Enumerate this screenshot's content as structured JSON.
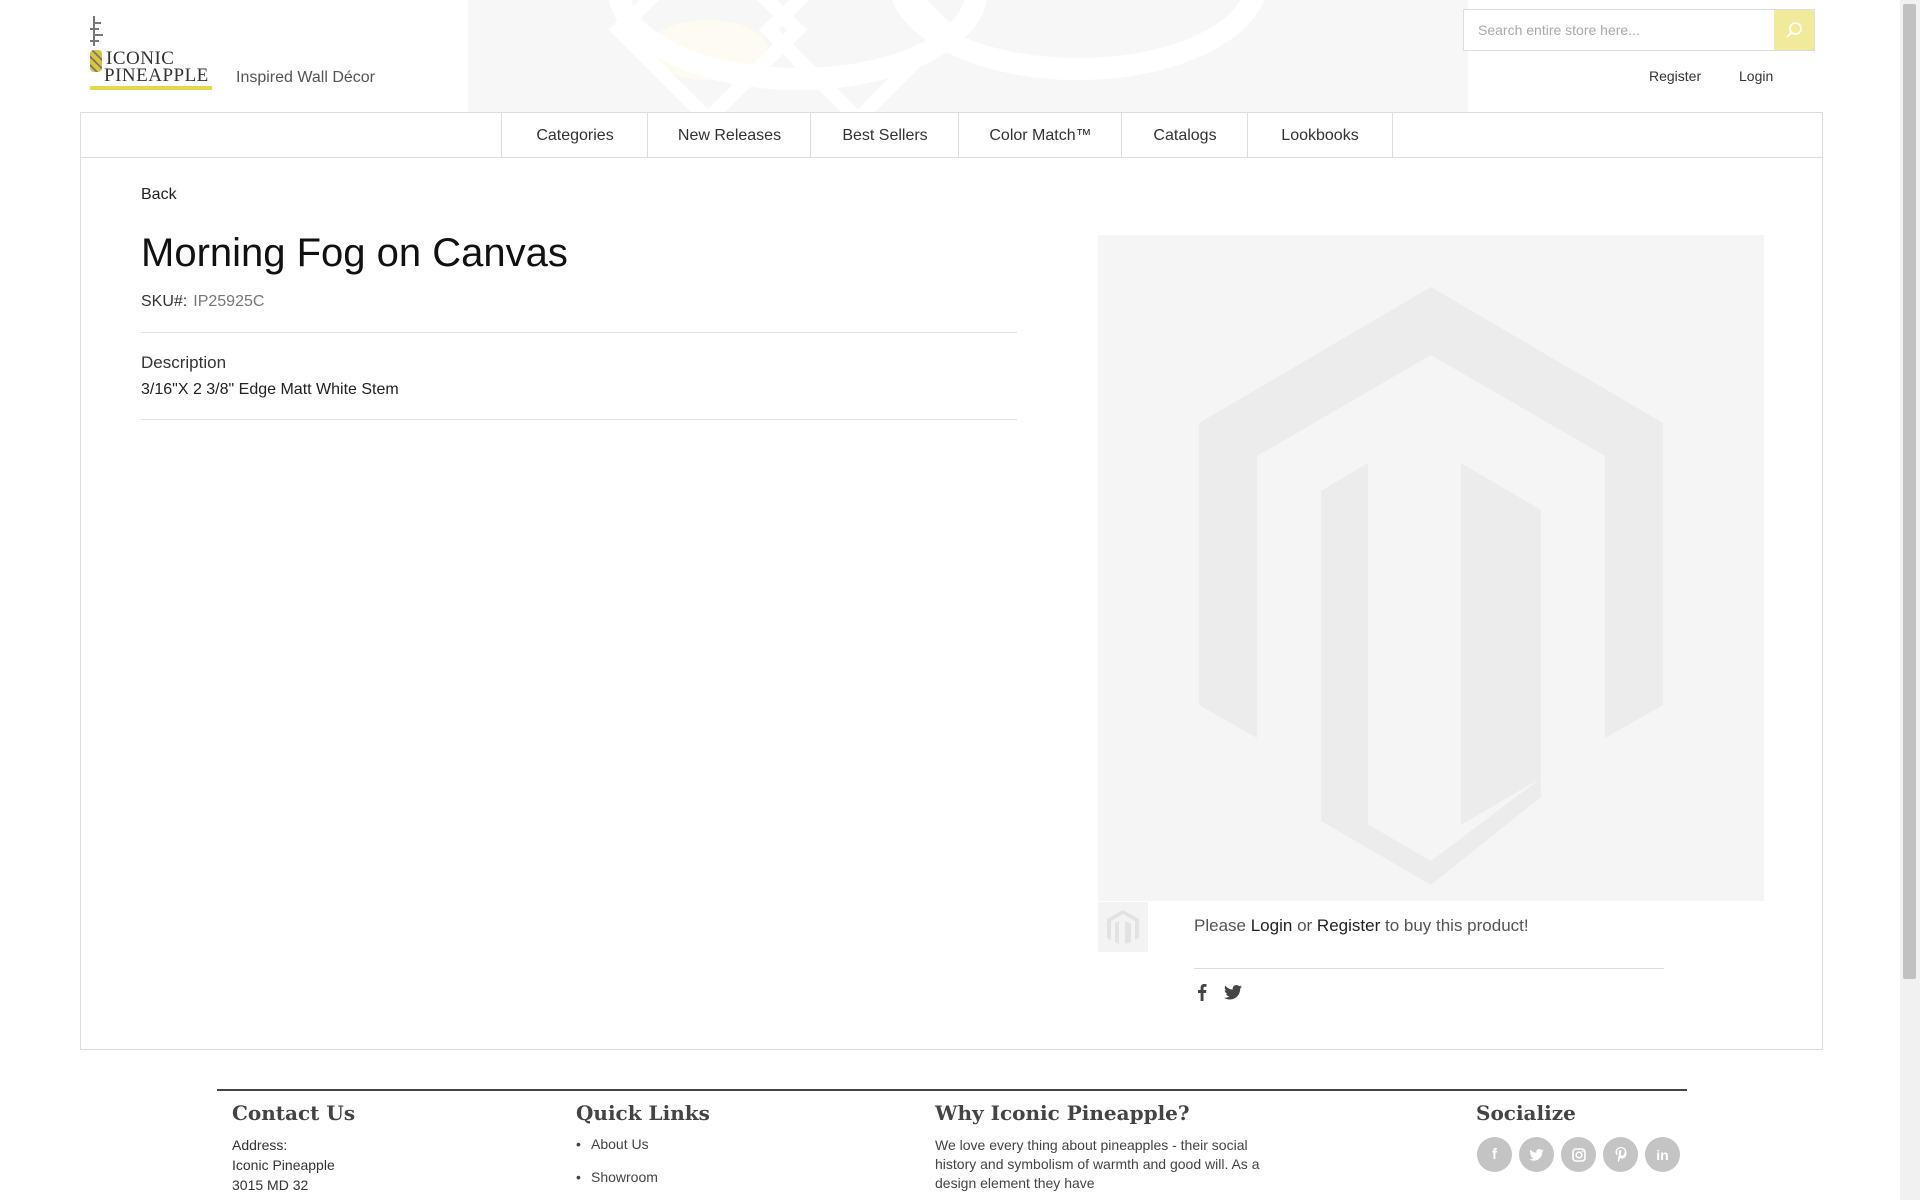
{
  "header": {
    "logo_line1": "ICONIC",
    "logo_line2": "PINEAPPLE",
    "tagline": "Inspired Wall Décor",
    "search_placeholder": "Search entire store here...",
    "register_label": "Register",
    "login_label": "Login"
  },
  "nav": {
    "items": [
      {
        "label": "Categories"
      },
      {
        "label": "New Releases"
      },
      {
        "label": "Best Sellers"
      },
      {
        "label": "Color Match™"
      },
      {
        "label": "Catalogs"
      },
      {
        "label": "Lookbooks"
      }
    ]
  },
  "product": {
    "back_label": "Back",
    "title": "Morning Fog on Canvas",
    "sku_label": "SKU#:",
    "sku_value": "IP25925C",
    "description_heading": "Description",
    "description_text": "3/16\"X 2 3/8\" Edge Matt White Stem",
    "buy_prefix": "Please",
    "buy_login": "Login",
    "buy_or": "or",
    "buy_register": "Register",
    "buy_suffix": "to buy this product!",
    "share_icons": [
      "facebook-icon",
      "twitter-icon"
    ]
  },
  "footer": {
    "contact": {
      "heading": "Contact Us",
      "address_label": "Address:",
      "address_line1": "Iconic Pineapple",
      "address_line2": "3015 MD 32"
    },
    "quick_links": {
      "heading": "Quick Links",
      "items": [
        "About Us",
        "Showroom"
      ]
    },
    "why": {
      "heading": "Why Iconic Pineapple?",
      "text": "We love every thing about pineapples - their social history and symbolism of warmth and good will. As a design element they have"
    },
    "socialize": {
      "heading": "Socialize",
      "icons": [
        "facebook-icon",
        "twitter-icon",
        "instagram-icon",
        "pinterest-icon",
        "linkedin-icon"
      ]
    }
  },
  "colors": {
    "accent_yellow": "#e5d84f",
    "search_button": "#f1ea9a",
    "social_circle": "#c4c4c4"
  }
}
